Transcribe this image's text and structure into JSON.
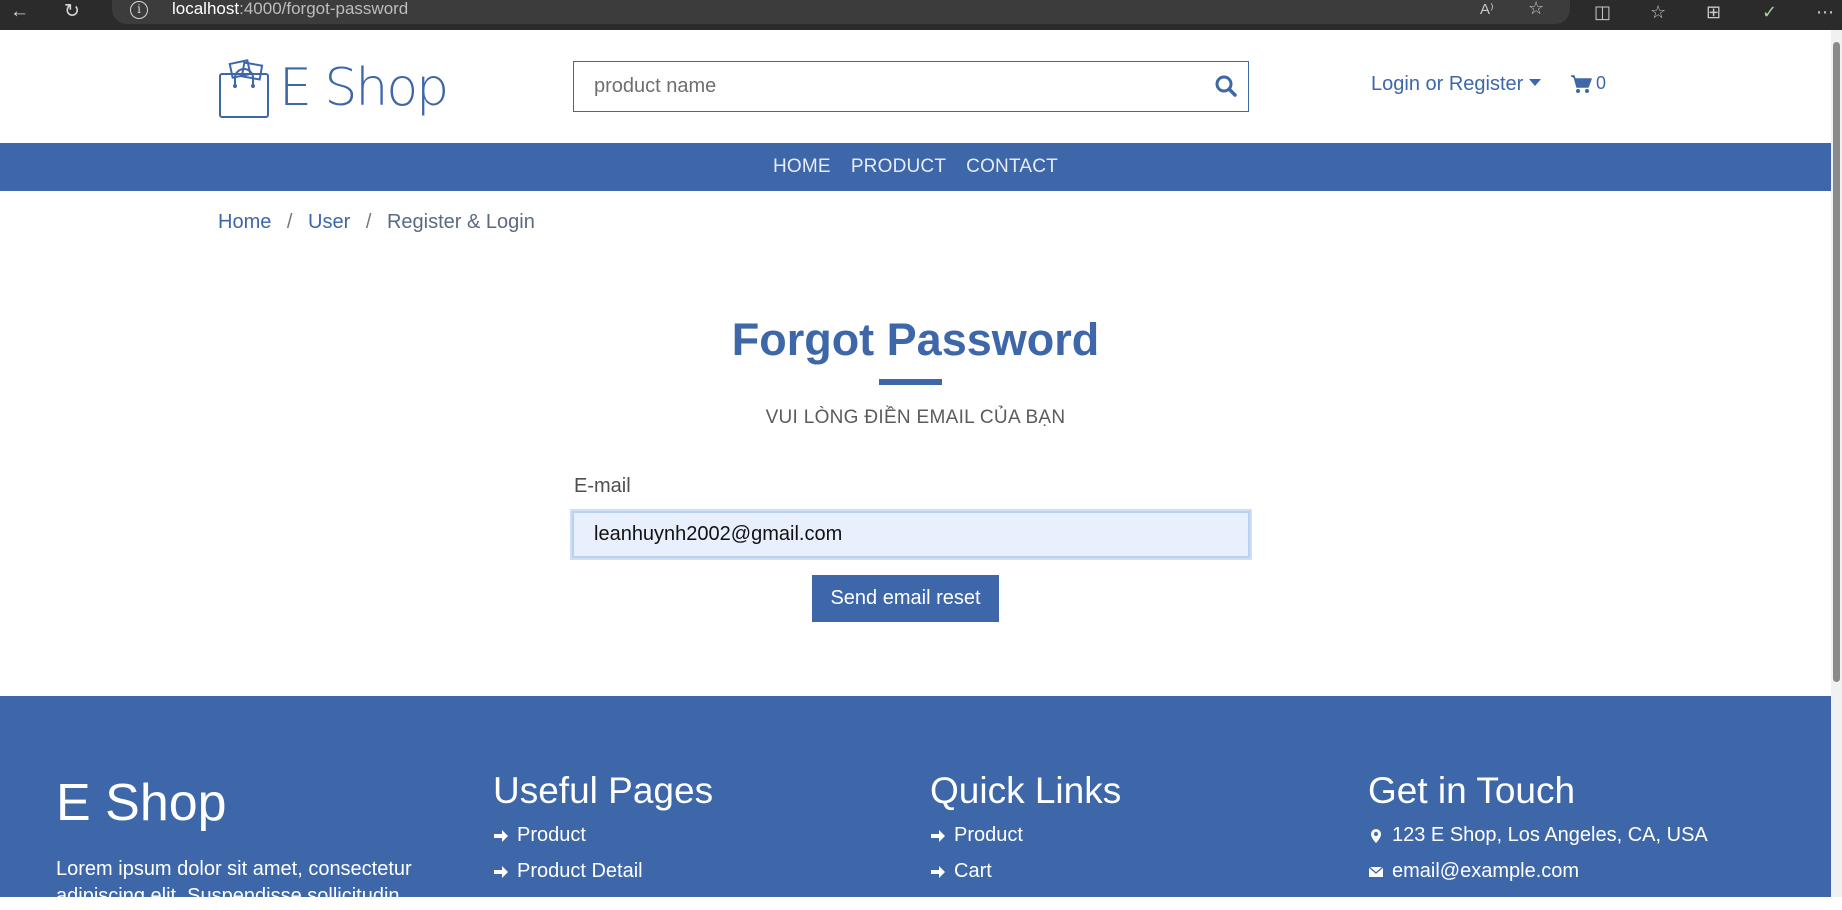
{
  "browser": {
    "url_host": "localhost",
    "url_path": ":4000/forgot-password",
    "info_glyph": "i"
  },
  "header": {
    "logo_text": "E Shop",
    "search_placeholder": "product name",
    "login_label": "Login or Register",
    "cart_count": "0"
  },
  "nav": {
    "items": [
      "HOME",
      "PRODUCT",
      "CONTACT"
    ]
  },
  "breadcrumb": {
    "items": [
      "Home",
      "User",
      "Register & Login"
    ],
    "separator": "/"
  },
  "form": {
    "title": "Forgot Password",
    "subtitle": "VUI LÒNG ĐIỀN EMAIL CỦA BẠN",
    "email_label": "E-mail",
    "email_value": "leanhuynh2002@gmail.com",
    "submit_label": "Send email reset"
  },
  "footer": {
    "brand": "E Shop",
    "description": "Lorem ipsum dolor sit amet, consectetur adipiscing elit. Suspendisse sollicitudin",
    "useful_pages": {
      "title": "Useful Pages",
      "links": [
        "Product",
        "Product Detail"
      ]
    },
    "quick_links": {
      "title": "Quick Links",
      "links": [
        "Product",
        "Cart"
      ]
    },
    "contact": {
      "title": "Get in Touch",
      "address": "123 E Shop, Los Angeles, CA, USA",
      "email": "email@example.com"
    }
  },
  "colors": {
    "brand": "#3e67a9",
    "input_autofill": "#e8f0fe",
    "chrome": "#2b2b2b"
  },
  "icons": [
    "back-arrow-icon",
    "refresh-icon",
    "info-icon",
    "read-aloud-icon",
    "favorite-star-icon",
    "split-screen-icon",
    "favorites-icon",
    "collections-icon",
    "extension-icon",
    "more-icon",
    "shopping-bag-icon",
    "search-icon",
    "cart-icon",
    "arrow-right-icon",
    "map-marker-icon",
    "envelope-icon"
  ]
}
